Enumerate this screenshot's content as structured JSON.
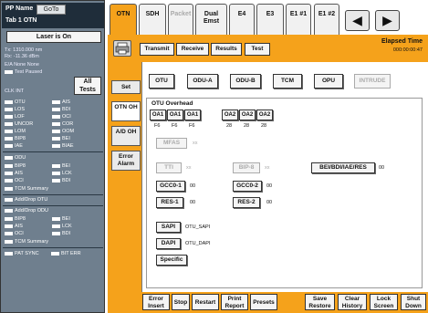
{
  "pp": {
    "name": "PP Name",
    "goto": "GoTo",
    "tab": "Tab 1 OTN"
  },
  "laser": "Laser is On",
  "left_info": [
    "Tx: 1310.000 nm",
    "Rx: -11.36 dBm",
    "E/A None None",
    "Test Paused"
  ],
  "all_tests": "All Tests",
  "clk_int": "CLK INT",
  "otn_alarms": [
    [
      "OTU",
      "AIS"
    ],
    [
      "LOS",
      "BDI"
    ],
    [
      "LOF",
      "OCI"
    ],
    [
      "UNCOR",
      "COR"
    ],
    [
      "LOM",
      "OOM"
    ],
    [
      "BIP8",
      "BEI"
    ],
    [
      "IAE",
      "BIAE"
    ]
  ],
  "odu": {
    "title": "ODU",
    "alarms": [
      [
        "BIP8",
        "BEI"
      ],
      [
        "AIS",
        "LCK"
      ],
      [
        "OCI",
        "BDI"
      ]
    ],
    "summary": "TCM Summary"
  },
  "adddrop_otu": "Add/Drop OTU",
  "adddrop_odu": {
    "title": "Add/Drop ODU",
    "alarms": [
      [
        "BIP8",
        "BEI"
      ],
      [
        "AIS",
        "LCK"
      ],
      [
        "OCI",
        "BDI"
      ]
    ],
    "summary": "TCM Summary"
  },
  "pat": [
    "PAT SYNC",
    "BIT ERR"
  ],
  "tabs": [
    {
      "label": "OTN",
      "active": true,
      "dim": false
    },
    {
      "label": "SDH",
      "active": false,
      "dim": false
    },
    {
      "label": "Packet",
      "active": false,
      "dim": true
    },
    {
      "label": "Dual Emst",
      "active": false,
      "dim": false
    },
    {
      "label": "E4",
      "active": false,
      "dim": false
    },
    {
      "label": "E3",
      "active": false,
      "dim": false
    },
    {
      "label": "E1 #1",
      "active": false,
      "dim": false
    },
    {
      "label": "E1 #2",
      "active": false,
      "dim": false
    }
  ],
  "nav": {
    "prev": "◀",
    "next": "▶"
  },
  "toolbar": {
    "transmit": "Transmit",
    "receive": "Receive",
    "results": "Results",
    "test": "Test"
  },
  "elapsed": {
    "label": "Elapsed Time",
    "value": "000:00:00:47"
  },
  "subtabs": {
    "set": "Set",
    "otn_oh": "OTN OH",
    "ad_oh": "A/D OH",
    "error_alarm": "Error Alarm"
  },
  "layers": {
    "otu": "OTU",
    "odua": "ODU-A",
    "odub": "ODU-B",
    "tcm": "TCM",
    "opu": "OPU",
    "intrude": "INTRUDE"
  },
  "overhead": {
    "title": "OTU Overhead",
    "oa1": [
      "OA1",
      "OA1",
      "OA1"
    ],
    "oa1_vals": [
      "F6",
      "F6",
      "F6"
    ],
    "oa2": [
      "OA2",
      "OA2",
      "OA2"
    ],
    "oa2_vals": [
      "28",
      "28",
      "28"
    ],
    "mfas": {
      "label": "MFAS",
      "value": "xx"
    },
    "tti": {
      "label": "TTI",
      "value": "xx"
    },
    "bip8": {
      "label": "BIP-8",
      "value": "xx"
    },
    "bei": {
      "label": "BEI/BDI/IAE/RES",
      "value": "00"
    },
    "gcc01": {
      "label": "GCC0-1",
      "value": "00"
    },
    "gcc02": {
      "label": "GCC0-2",
      "value": "00"
    },
    "res1": {
      "label": "RES-1",
      "value": "00"
    },
    "res2": {
      "label": "RES-2",
      "value": "00"
    },
    "sapi": {
      "label": "SAPI",
      "value": "OTU_SAPI"
    },
    "dapi": {
      "label": "DAPI",
      "value": "OTU_DAPI"
    },
    "specific": "Specific"
  },
  "bottom": {
    "error_insert": "Error Insert",
    "stop": "Stop",
    "restart": "Restart",
    "print_report": "Print Report",
    "presets": "Presets",
    "save_restore": "Save Restore",
    "clear_history": "Clear History",
    "lock_screen": "Lock Screen",
    "shut_down": "Shut Down"
  },
  "colors": {
    "accent": "#f5a21b",
    "panel": "#6f7f8e",
    "header": "#1f2d3a",
    "led": "#ffffff"
  }
}
